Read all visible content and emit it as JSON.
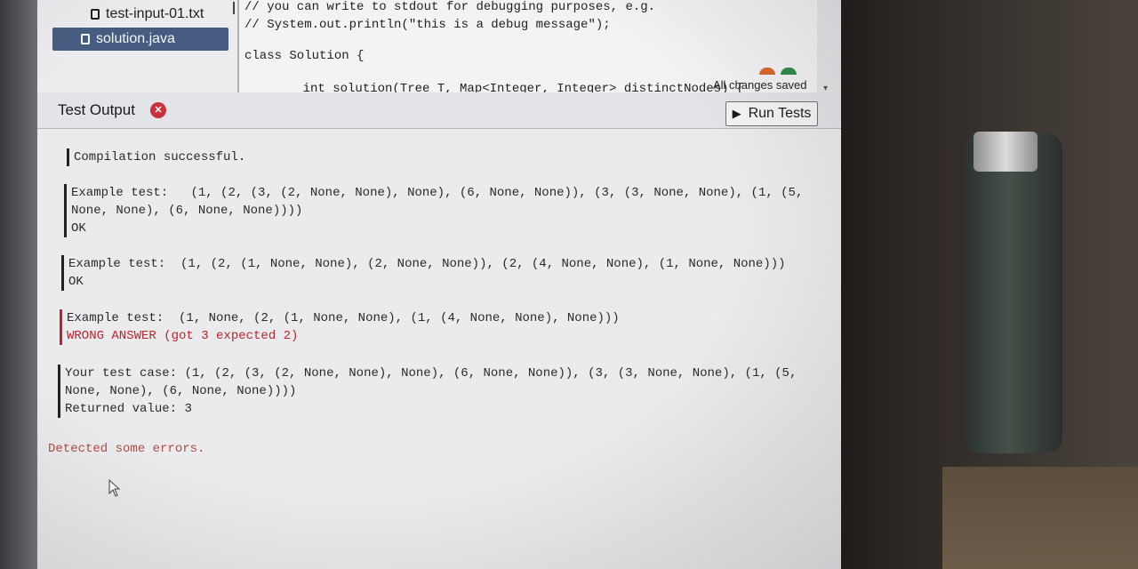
{
  "files": [
    {
      "name": "test-input-01.txt",
      "active": false
    },
    {
      "name": "solution.java",
      "active": true
    }
  ],
  "editor": {
    "lines": [
      "// you can write to stdout for debugging purposes, e.g.",
      "// System.out.println(\"this is a debug message\");",
      "",
      "class Solution {",
      "",
      "    int solution(Tree T, Map<Integer, Integer> distinctNodes) {"
    ],
    "save_status": "All changes saved"
  },
  "output": {
    "title": "Test Output",
    "run_button_label": "Run Tests",
    "compilation": "Compilation successful.",
    "tests": [
      {
        "label": "Example test:",
        "value_line1": "(1, (2, (3, (2, None, None), None), (6, None, None)), (3, (3, None, None), (1, (5,",
        "value_line2": "None, None), (6, None, None))))",
        "result": "OK",
        "status": "pass"
      },
      {
        "label": "Example test:",
        "value_line1": "(1, (2, (1, None, None), (2, None, None)), (2, (4, None, None), (1, None, None)))",
        "result": "OK",
        "status": "pass"
      },
      {
        "label": "Example test:",
        "value_line1": "(1, None, (2, (1, None, None), (1, (4, None, None), None)))",
        "result": "WRONG ANSWER (got 3 expected 2)",
        "status": "fail"
      }
    ],
    "custom_test": {
      "label": "Your test case:",
      "value_line1": "(1, (2, (3, (2, None, None), None), (6, None, None)), (3, (3, None, None), (1, (5,",
      "value_line2": "None, None), (6, None, None))))",
      "returned_label": "Returned value:",
      "returned_value": "3"
    },
    "summary": "Detected some errors."
  },
  "colors": {
    "active_file_bg": "#465c80",
    "fail_red": "#b8262d",
    "close_icon_red": "#c8323a"
  }
}
